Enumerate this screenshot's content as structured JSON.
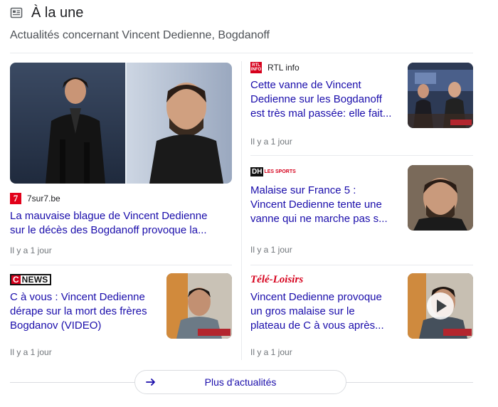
{
  "header": {
    "icon": "newspaper-icon",
    "title": "À la une",
    "subtitle": "Actualités concernant Vincent Dedienne, Bogdanoff"
  },
  "articles": [
    {
      "source": "7sur7.be",
      "logo_text": "7",
      "headline_line1": "La mauvaise blague de Vincent Dedienne",
      "headline_line2": "sur le décès des Bogdanoff provoque la...",
      "time": "Il y a 1 jour"
    },
    {
      "source": "RTL info",
      "logo_text": "RTL INFO",
      "headline_line1": "Cette vanne de Vincent",
      "headline_line2": "Dedienne sur les Bogdanoff",
      "headline_line3": "est très mal passée: elle fait...",
      "time": "Il y a 1 jour"
    },
    {
      "source": "DH Les Sports",
      "logo_text_main": "DH",
      "logo_text_sub": "LES SPORTS",
      "headline_line1": "Malaise sur France 5 :",
      "headline_line2": "Vincent Dedienne tente une",
      "headline_line3": "vanne qui ne marche pas s...",
      "time": "Il y a 1 jour"
    },
    {
      "source": "CNEWS",
      "logo_text_c": "C",
      "logo_text_news": "NEWS",
      "headline_line1": "C à vous : Vincent Dedienne",
      "headline_line2": "dérape sur la mort des frères",
      "headline_line3": "Bogdanov (VIDEO)",
      "time": "Il y a 1 jour"
    },
    {
      "source": "Télé-Loisirs",
      "logo_text": "Télé-Loisirs",
      "headline_line1": "Vincent Dedienne provoque",
      "headline_line2": "un gros malaise sur le",
      "headline_line3": "plateau de C à vous après...",
      "time": "Il y a 1 jour"
    }
  ],
  "more": {
    "label": "Plus d'actualités",
    "icon": "arrow-right-icon"
  },
  "colors": {
    "link": "#1a0dab",
    "meta": "#70757a",
    "divider": "#e8eaed"
  }
}
